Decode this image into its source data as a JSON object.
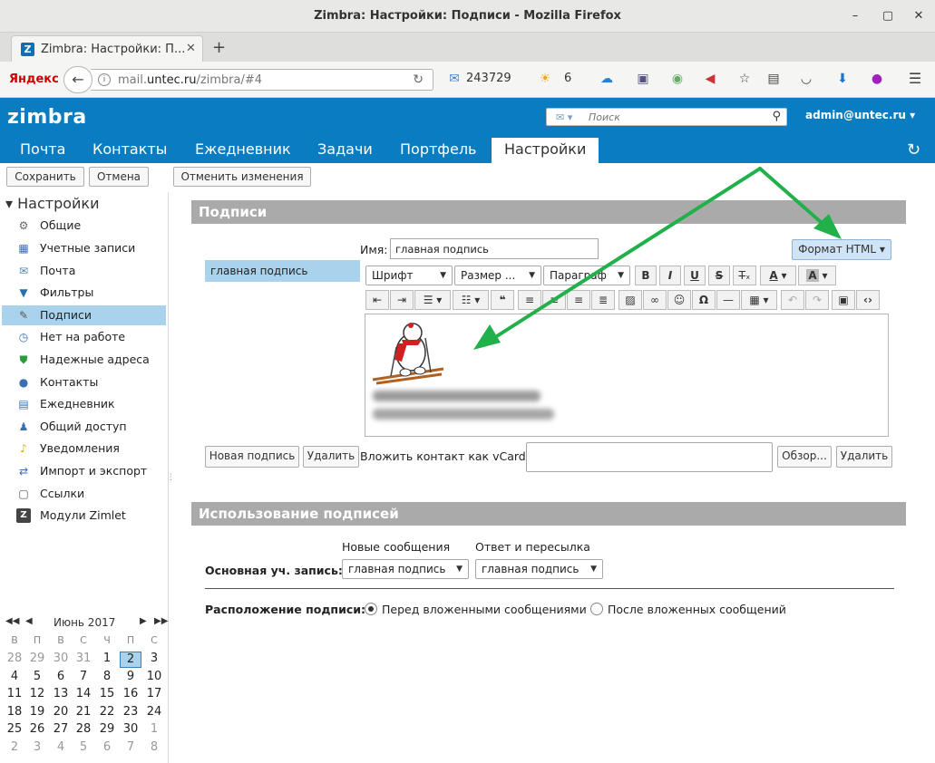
{
  "window": {
    "title": "Zimbra: Настройки: Подписи - Mozilla Firefox",
    "minimize": "–",
    "maximize": "▢",
    "close": "✕"
  },
  "browser": {
    "tab_title": "Zimbra: Настройки: П...",
    "tab_logo": "Z",
    "tab_close": "✕",
    "new_tab": "+",
    "yandex": "Яндекс",
    "url_prefix": "mail.",
    "url_domain": "untec.ru",
    "url_suffix": "/zimbra/#4",
    "mail_count": "243729",
    "weather": "6",
    "icons": [
      "mail-icon",
      "weather-icon",
      "cloud-icon",
      "extension-icon",
      "extension-icon",
      "speaker-icon",
      "bookmark-star-icon",
      "clipboard-icon",
      "pocket-icon",
      "download-icon",
      "notification-icon",
      "menu-icon"
    ]
  },
  "zimbra": {
    "logo": "zimbra",
    "search_placeholder": "Поиск",
    "user": "admin@untec.ru ▾",
    "tabs": [
      "Почта",
      "Контакты",
      "Ежедневник",
      "Задачи",
      "Портфель",
      "Настройки"
    ],
    "toolbar": {
      "save": "Сохранить",
      "cancel": "Отмена",
      "revert": "Отменить изменения"
    }
  },
  "sidebar": {
    "title": "Настройки",
    "items": [
      {
        "label": "Общие",
        "icon": "gear-icon"
      },
      {
        "label": "Учетные записи",
        "icon": "accounts-icon"
      },
      {
        "label": "Почта",
        "icon": "mail-icon"
      },
      {
        "label": "Фильтры",
        "icon": "filter-icon"
      },
      {
        "label": "Подписи",
        "icon": "signature-icon"
      },
      {
        "label": "Нет на работе",
        "icon": "out-of-office-icon"
      },
      {
        "label": "Надежные адреса",
        "icon": "shield-icon"
      },
      {
        "label": "Контакты",
        "icon": "contact-icon"
      },
      {
        "label": "Ежедневник",
        "icon": "calendar-icon"
      },
      {
        "label": "Общий доступ",
        "icon": "sharing-icon"
      },
      {
        "label": "Уведомления",
        "icon": "bell-icon"
      },
      {
        "label": "Импорт и экспорт",
        "icon": "import-export-icon"
      },
      {
        "label": "Ссылки",
        "icon": "shortcuts-icon"
      },
      {
        "label": "Модули Zimlet",
        "icon": "zimlet-icon"
      }
    ],
    "selected_index": 4
  },
  "calendar": {
    "month": "Июнь 2017",
    "dow": [
      "В",
      "П",
      "В",
      "С",
      "Ч",
      "П",
      "С"
    ],
    "weeks": [
      [
        "28",
        "29",
        "30",
        "31",
        "1",
        "2",
        "3"
      ],
      [
        "4",
        "5",
        "6",
        "7",
        "8",
        "9",
        "10"
      ],
      [
        "11",
        "12",
        "13",
        "14",
        "15",
        "16",
        "17"
      ],
      [
        "18",
        "19",
        "20",
        "21",
        "22",
        "23",
        "24"
      ],
      [
        "25",
        "26",
        "27",
        "28",
        "29",
        "30",
        "1"
      ],
      [
        "2",
        "3",
        "4",
        "5",
        "6",
        "7",
        "8"
      ]
    ],
    "today": "2"
  },
  "signatures": {
    "section_title": "Подписи",
    "list": [
      "главная подпись"
    ],
    "name_label": "Имя:",
    "name_value": "главная подпись",
    "format_button": "Формат HTML",
    "editor": {
      "font": "Шрифт",
      "size": "Размер ...",
      "paragraph": "Параграф"
    },
    "new_button": "Новая подпись",
    "delete_button": "Удалить",
    "vcard_label": "Вложить контакт как vCard:",
    "browse_button": "Обзор...",
    "delete_vcard_button": "Удалить"
  },
  "usage": {
    "section_title": "Использование подписей",
    "col_new": "Новые сообщения",
    "col_reply": "Ответ и пересылка",
    "primary_label": "Основная уч. запись:",
    "new_value": "главная подпись",
    "reply_value": "главная подпись",
    "placement_label": "Расположение подписи:",
    "placement_before": "Перед вложенными сообщениями",
    "placement_after": "После вложенных сообщений",
    "placement_selected": "before"
  }
}
